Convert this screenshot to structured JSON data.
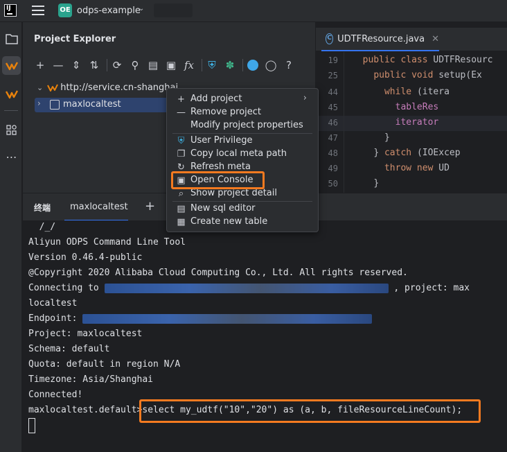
{
  "titlebar": {
    "logo_text": "IJ",
    "project_badge": "OE",
    "project_name": "odps-example"
  },
  "explorer": {
    "title": "Project Explorer",
    "tree": [
      {
        "label": "http://service.cn-shanghai.",
        "expanded": true
      },
      {
        "label": "maxlocaltest",
        "expanded": false,
        "selected": true
      }
    ]
  },
  "context_menu": {
    "items": [
      {
        "label": "Add project",
        "icon": "plus-icon",
        "submenu": true
      },
      {
        "label": "Remove project",
        "icon": "minus-icon"
      },
      {
        "label": "Modify project properties",
        "icon": ""
      },
      {
        "label": "User Privilege",
        "icon": "shield-icon"
      },
      {
        "label": "Copy local meta path",
        "icon": "copy-icon"
      },
      {
        "label": "Refresh meta",
        "icon": "refresh-icon"
      },
      {
        "label": "Open Console",
        "icon": "sql-console-icon",
        "highlighted": true
      },
      {
        "label": "Show project detail",
        "icon": "detail-search-icon"
      },
      {
        "label": "New sql editor",
        "icon": "sql-file-icon"
      },
      {
        "label": "Create new table",
        "icon": "table-icon"
      }
    ]
  },
  "editor": {
    "tab_label": "UDTFResource.java",
    "tab_icon_letter": "C",
    "lines": [
      {
        "num": "19",
        "indent": "  ",
        "parts": [
          {
            "t": "public class ",
            "k": "kw"
          },
          {
            "t": "UDTFResourc",
            "k": ""
          }
        ]
      },
      {
        "num": "25",
        "indent": "    ",
        "parts": [
          {
            "t": "public void ",
            "k": "kw"
          },
          {
            "t": "setup(Ex",
            "k": ""
          }
        ]
      },
      {
        "num": "44",
        "indent": "      ",
        "parts": [
          {
            "t": "while ",
            "k": "kw"
          },
          {
            "t": "(itera",
            "k": ""
          }
        ]
      },
      {
        "num": "45",
        "indent": "        ",
        "parts": [
          {
            "t": "tableRes",
            "k": "fld"
          }
        ]
      },
      {
        "num": "46",
        "indent": "        ",
        "parts": [
          {
            "t": "iterator",
            "k": "fld"
          }
        ],
        "current": true
      },
      {
        "num": "47",
        "indent": "      ",
        "parts": [
          {
            "t": "}",
            "k": ""
          }
        ]
      },
      {
        "num": "48",
        "indent": "    ",
        "parts": [
          {
            "t": "} ",
            "k": ""
          },
          {
            "t": "catch ",
            "k": "kw"
          },
          {
            "t": "(IOExcep",
            "k": ""
          }
        ]
      },
      {
        "num": "49",
        "indent": "      ",
        "parts": [
          {
            "t": "throw new ",
            "k": "kw"
          },
          {
            "t": "UD",
            "k": ""
          }
        ]
      },
      {
        "num": "50",
        "indent": "    ",
        "parts": [
          {
            "t": "}",
            "k": ""
          }
        ]
      }
    ]
  },
  "terminal": {
    "panel_title": "终端",
    "tab_label": "maxlocaltest",
    "lines": {
      "ascii": "  /_/",
      "tool": "Aliyun ODPS Command Line Tool",
      "version": "Version 0.46.4-public",
      "copyright": "@Copyright 2020 Alibaba Cloud Computing Co., Ltd. All rights reserved.",
      "connecting_pre": "Connecting to ",
      "connecting_post": " , project: max",
      "connecting_wrap": "localtest",
      "endpoint": "Endpoint: ",
      "project": "Project: maxlocaltest",
      "schema": "Schema: default",
      "quota": "Quota: default in region N/A",
      "timezone": "Timezone: Asia/Shanghai",
      "connected": "Connected!",
      "prompt": "maxlocaltest.default>",
      "command": "select my_udtf(\"10\",\"20\") as (a, b, fileResourceLineCount);"
    }
  },
  "colors": {
    "accent": "#3574f0",
    "highlight": "#f47a20",
    "odps_orange": "#e8820c"
  }
}
